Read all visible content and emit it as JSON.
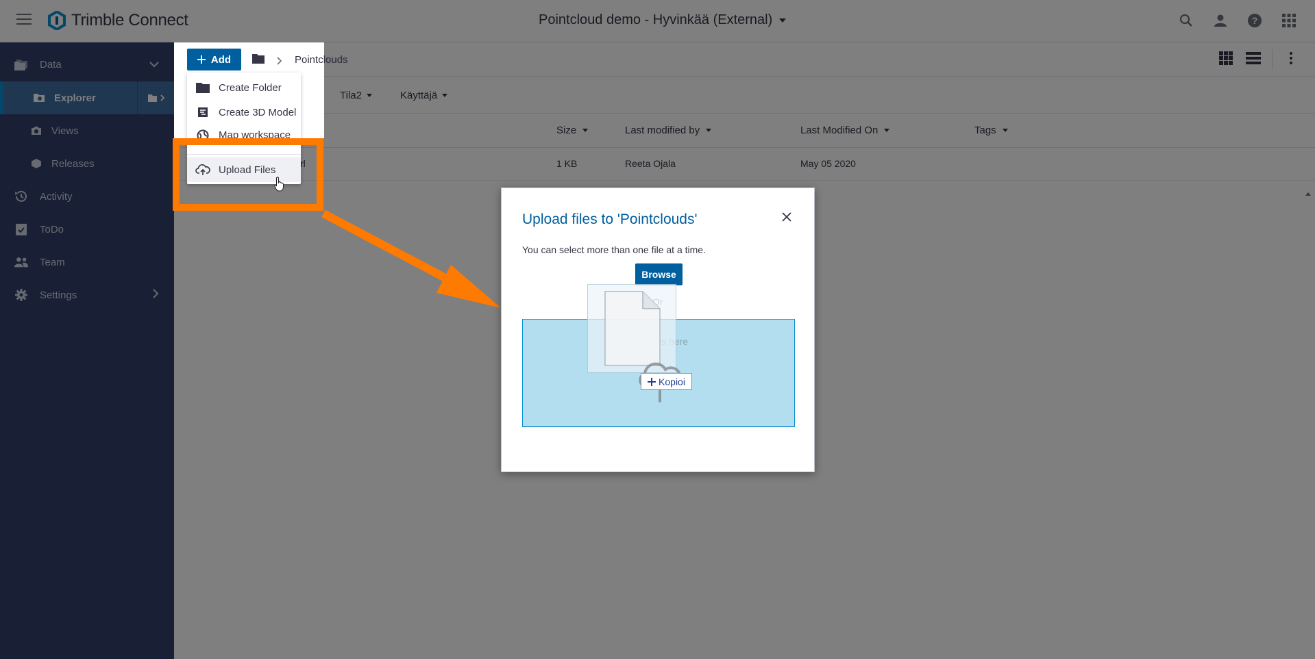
{
  "topbar": {
    "brand": "Trimble Connect",
    "project": "Pointcloud demo - Hyvinkää (External)",
    "icons": [
      "search-icon",
      "user-icon",
      "help-icon",
      "apps-grid-icon"
    ]
  },
  "sidebar": {
    "items": [
      {
        "label": "Data",
        "icon": "folders-icon"
      },
      {
        "label": "Explorer",
        "icon": "explorer-icon"
      },
      {
        "label": "Views",
        "icon": "camera-icon"
      },
      {
        "label": "Releases",
        "icon": "cube-icon"
      },
      {
        "label": "Activity",
        "icon": "history-icon"
      },
      {
        "label": "ToDo",
        "icon": "clipboard-check-icon"
      },
      {
        "label": "Team",
        "icon": "team-icon"
      },
      {
        "label": "Settings",
        "icon": "gear-icon"
      }
    ]
  },
  "toolbar": {
    "add_label": "Add",
    "breadcrumb_current": "Pointclouds"
  },
  "filters": {
    "items": [
      "Tila2",
      "Käyttäjä"
    ]
  },
  "table": {
    "headers": {
      "size": "Size",
      "modified_by": "Last modified by",
      "modified_on": "Last Modified On",
      "tags": "Tags"
    },
    "rows": [
      {
        "name_fragment": "rl",
        "size": "1 KB",
        "modified_by": "Reeta Ojala",
        "modified_on": "May 05 2020"
      }
    ]
  },
  "add_menu": {
    "items": [
      {
        "label": "Create Folder",
        "icon": "folder-icon"
      },
      {
        "label": "Create 3D Model",
        "icon": "model-3d-icon"
      },
      {
        "label": "Map workspace",
        "icon": "globe-icon"
      },
      {
        "label": "Upload Files",
        "icon": "cloud-upload-icon"
      }
    ]
  },
  "modal": {
    "title": "Upload files to 'Pointclouds'",
    "hint": "You can select more than one file at a time.",
    "browse_label": "Browse",
    "or_label": "Or",
    "drop_label": "Drop files here",
    "copy_label": "Kopioi"
  },
  "colors": {
    "brand_blue": "#005f9e",
    "sidebar_bg": "#32416a",
    "annotation_orange": "#ff7a00",
    "dropzone_bg": "#b3def0"
  }
}
